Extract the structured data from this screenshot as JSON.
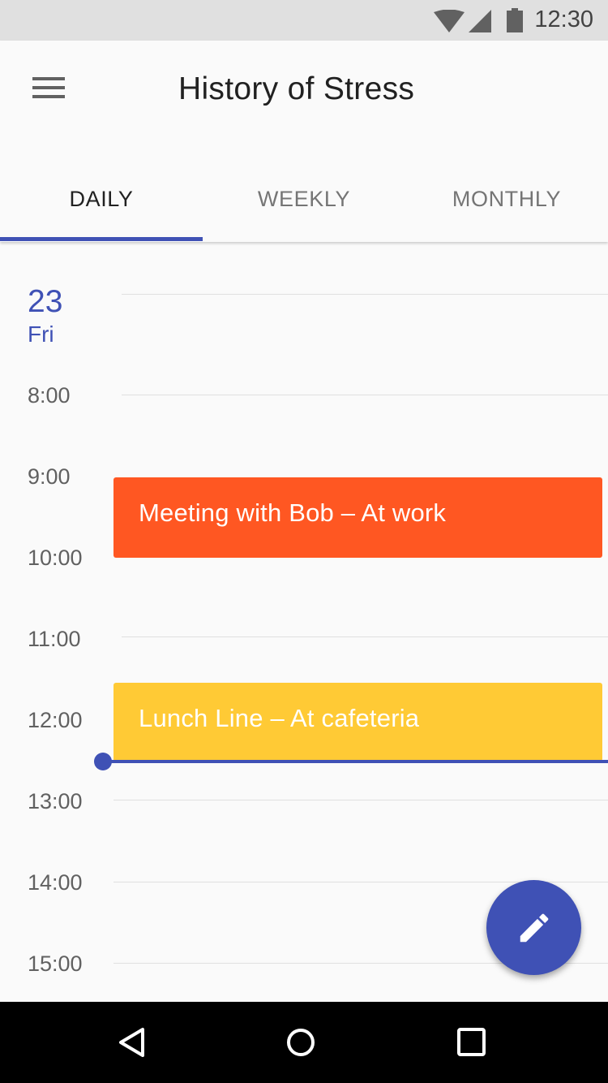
{
  "status_bar": {
    "time": "12:30",
    "icons": [
      "wifi-icon",
      "signal-icon",
      "battery-icon"
    ]
  },
  "app_bar": {
    "title": "History of Stress",
    "menu_icon": "menu-icon"
  },
  "tabs": [
    {
      "label": "DAILY",
      "active": true
    },
    {
      "label": "WEEKLY",
      "active": false
    },
    {
      "label": "MONTHLY",
      "active": false
    }
  ],
  "day": {
    "number": "23",
    "weekday": "Fri"
  },
  "hours": [
    "8:00",
    "9:00",
    "10:00",
    "11:00",
    "12:00",
    "13:00",
    "14:00",
    "15:00"
  ],
  "events": [
    {
      "title": "Meeting with Bob – At work",
      "color": "#FF5722"
    },
    {
      "title": "Lunch Line – At cafeteria",
      "color": "#FFCA35"
    }
  ],
  "fab": {
    "icon": "pencil-icon"
  },
  "nav_bar": {
    "icons": [
      "back-icon",
      "home-icon",
      "recents-icon"
    ]
  },
  "colors": {
    "primary": "#3F51B5",
    "status_bar": "#E0E0E0",
    "background": "#FAFAFA"
  }
}
